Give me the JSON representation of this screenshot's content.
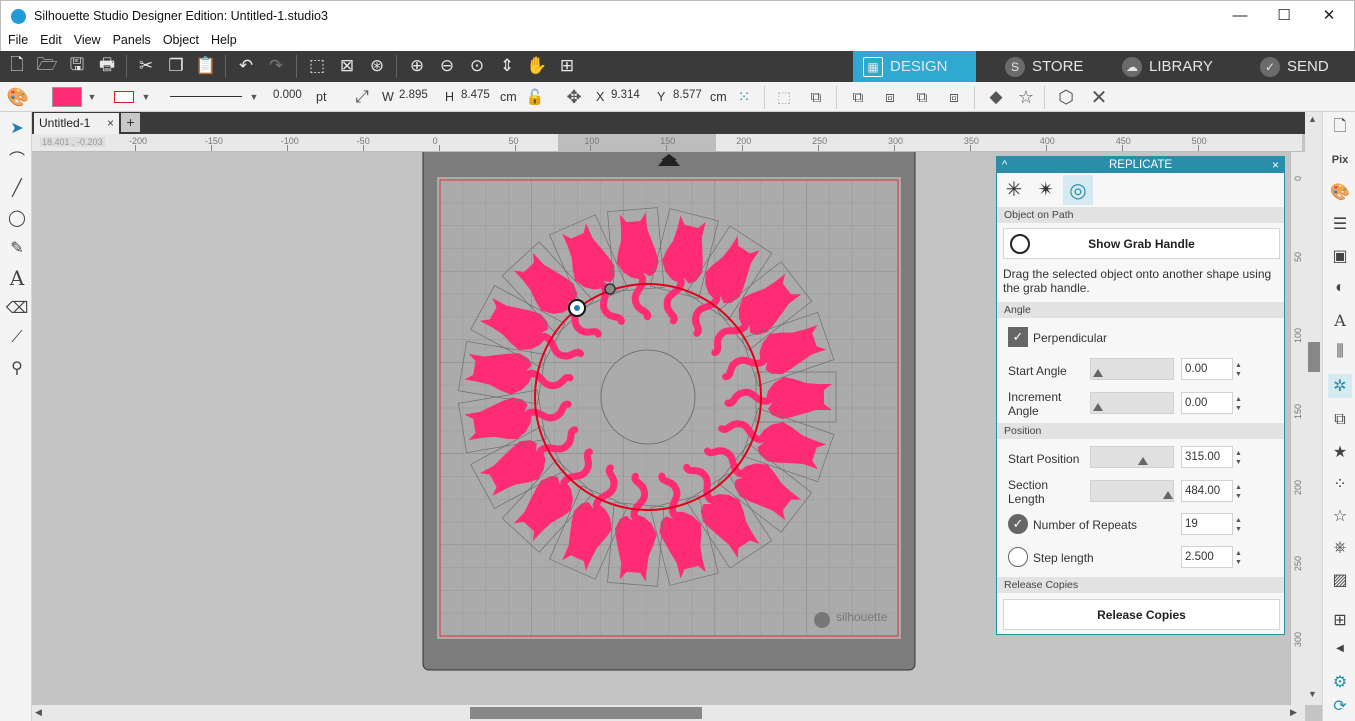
{
  "window": {
    "title": "Silhouette Studio Designer Edition: Untitled-1.studio3",
    "minimize": "—",
    "maximize": "☐",
    "close": "✕"
  },
  "menu": [
    "File",
    "Edit",
    "View",
    "Panels",
    "Object",
    "Help"
  ],
  "nav_tabs": [
    {
      "label": "DESIGN",
      "active": true
    },
    {
      "label": "STORE",
      "active": false
    },
    {
      "label": "LIBRARY",
      "active": false
    },
    {
      "label": "SEND",
      "active": false
    }
  ],
  "toolbar2": {
    "fill_color": "#ff2b74",
    "line_color": "#e02020",
    "line_width": "0.000",
    "line_unit": "pt",
    "w_label": "W",
    "w_value": "2.895",
    "h_label": "H",
    "h_value": "8.475",
    "size_unit": "cm",
    "x_label": "X",
    "x_value": "9.314",
    "y_label": "Y",
    "y_value": "8.577",
    "pos_unit": "cm"
  },
  "document_tab": {
    "name": "Untitled-1",
    "close": "×",
    "add": "+"
  },
  "ruler": {
    "coordinate": "18.401 , -0.203",
    "h_ticks": [
      "-200",
      "-150",
      "-100",
      "-50",
      "0",
      "50",
      "100",
      "150",
      "200",
      "250",
      "300",
      "350",
      "400",
      "450",
      "500"
    ],
    "v_ticks": [
      "0",
      "50",
      "100",
      "150",
      "200",
      "250",
      "300"
    ]
  },
  "mat": {
    "brand": "silhouette"
  },
  "replicate_panel": {
    "title": "REPLICATE",
    "collapse": "^",
    "close": "×",
    "section_object_on_path": "Object on Path",
    "show_grab_handle": "Show Grab Handle",
    "description": "Drag the selected object onto another shape using the grab handle.",
    "section_angle": "Angle",
    "perpendicular": {
      "label": "Perpendicular",
      "checked": true
    },
    "start_angle": {
      "label": "Start Angle",
      "value": "0.00",
      "level": 0
    },
    "increment_angle": {
      "label": "Increment Angle",
      "value": "0.00",
      "level": 0
    },
    "section_position": "Position",
    "start_position": {
      "label": "Start Position",
      "value": "315.00",
      "level": 0.63
    },
    "section_length": {
      "label": "Section Length",
      "value": "484.00",
      "level": 0.97
    },
    "number_of_repeats": {
      "label": "Number of Repeats",
      "value": "19",
      "selected": true
    },
    "step_length": {
      "label": "Step length",
      "value": "2.500",
      "selected": false
    },
    "section_release": "Release Copies",
    "release_copies": "Release Copies"
  },
  "design": {
    "copies": 19,
    "shape_color": "#ff2b74",
    "path_color": "#e0001a"
  }
}
